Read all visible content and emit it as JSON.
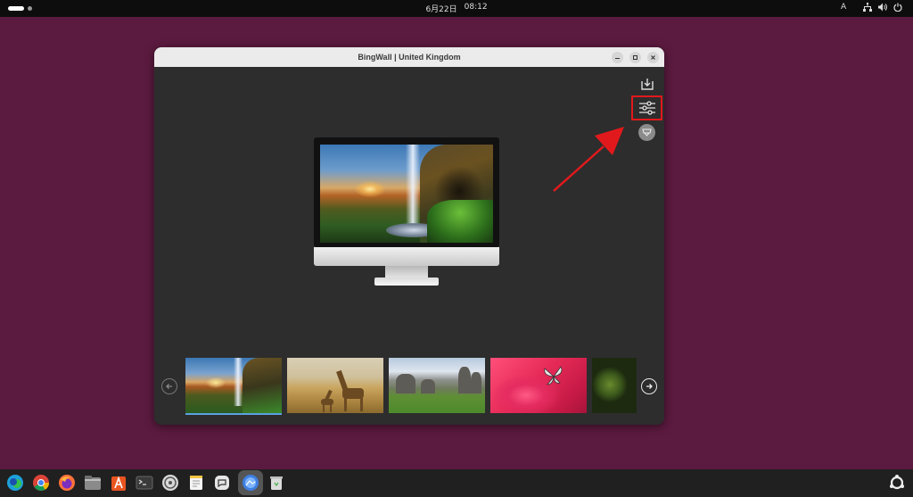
{
  "topbar": {
    "date": "6月22日",
    "time": "08:12",
    "input_method": "A"
  },
  "window": {
    "title": "BingWall | United Kingdom"
  },
  "icons": {
    "download": "download-icon",
    "settings": "sliders-icon",
    "set_wallpaper": "wallpaper-icon",
    "prev": "arrow-left-icon",
    "next": "arrow-right-icon"
  },
  "colors": {
    "desktop_bg": "#5b1a3f",
    "window_bg": "#2d2d2d",
    "highlight": "#e2191c",
    "annotation_arrow": "#e2191c"
  },
  "thumbnails": [
    {
      "subject": "waterfall-sunset",
      "selected": true
    },
    {
      "subject": "giraffes-savanna",
      "selected": false
    },
    {
      "subject": "mountain-valley",
      "selected": false
    },
    {
      "subject": "pink-flower-butterfly",
      "selected": false
    },
    {
      "subject": "mossy-trees",
      "selected": false
    }
  ],
  "dock": [
    "edge-browser-icon",
    "chrome-icon",
    "firefox-icon",
    "files-icon",
    "app-center-icon",
    "terminal-icon",
    "disk-icon",
    "text-editor-icon",
    "chat-icon",
    "bingwall-icon",
    "trash-icon",
    "show-apps-icon"
  ]
}
